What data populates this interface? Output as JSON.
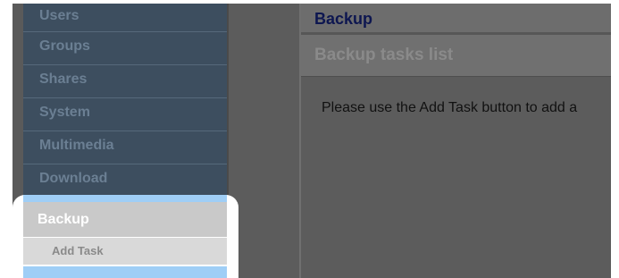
{
  "sidebar": {
    "items": [
      {
        "label": "Users"
      },
      {
        "label": "Groups"
      },
      {
        "label": "Shares"
      },
      {
        "label": "System"
      },
      {
        "label": "Multimedia"
      },
      {
        "label": "Download"
      }
    ],
    "active": {
      "label": "Backup",
      "sub_items": [
        {
          "label": "Add Task"
        }
      ]
    }
  },
  "main": {
    "header": "Backup",
    "panel_title": "Backup tasks list",
    "message": "Please use the Add Task button to add a"
  },
  "colors": {
    "sidebar_bg": "#3d4e5f",
    "highlight_blue": "#9fcef6",
    "header_text": "#0d1650"
  }
}
